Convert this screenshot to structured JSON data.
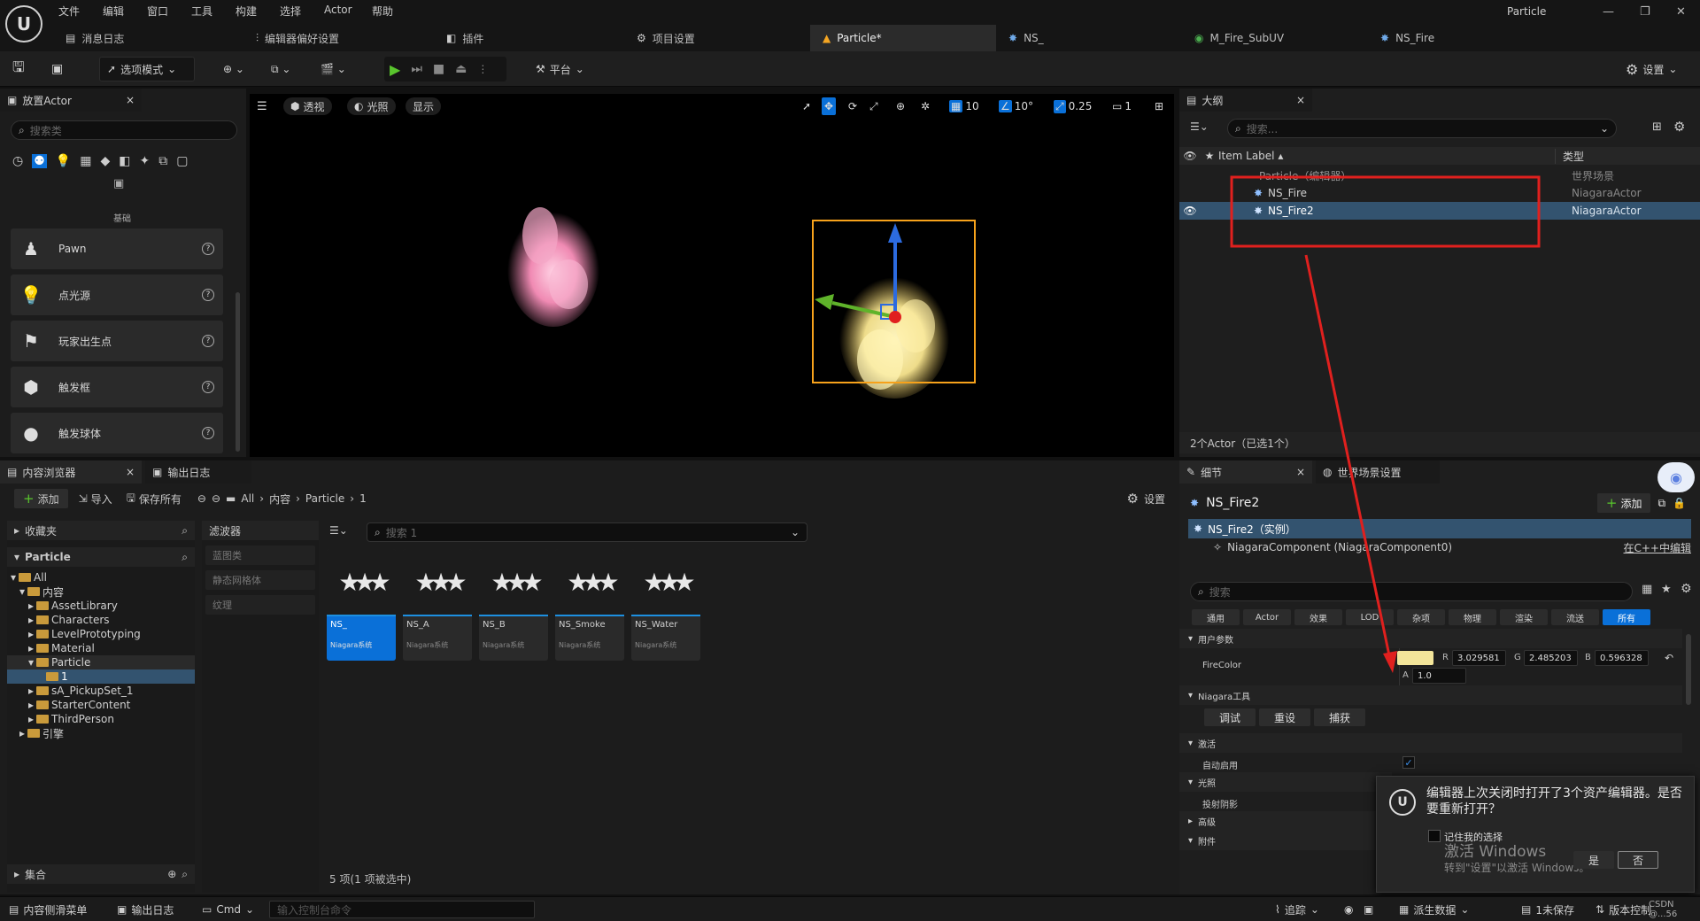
{
  "menu": [
    "文件",
    "编辑",
    "窗口",
    "工具",
    "构建",
    "选择",
    "Actor",
    "帮助"
  ],
  "window_title": "Particle",
  "doc_tabs": [
    {
      "label": "消息日志",
      "icon": "message-log-icon"
    },
    {
      "label": "编辑器偏好设置",
      "icon": "sliders-icon"
    },
    {
      "label": "插件",
      "icon": "plugin-icon"
    },
    {
      "label": "项目设置",
      "icon": "settings-icon"
    },
    {
      "label": "Particle*",
      "icon": "level-icon",
      "active": true
    },
    {
      "label": "NS_",
      "icon": "niagara-icon"
    },
    {
      "label": "M_Fire_SubUV",
      "icon": "material-icon"
    },
    {
      "label": "NS_Fire",
      "icon": "niagara-icon"
    }
  ],
  "toolbar": {
    "mode_label": "选项模式",
    "platform_label": "平台",
    "settings_label": "设置"
  },
  "place_actors": {
    "tab_label": "放置Actor",
    "search_placeholder": "搜索类",
    "category_label": "基础",
    "items": [
      {
        "label": "Pawn",
        "icon": "pawn-icon"
      },
      {
        "label": "点光源",
        "icon": "point-light-icon"
      },
      {
        "label": "玩家出生点",
        "icon": "player-start-icon"
      },
      {
        "label": "触发框",
        "icon": "trigger-box-icon"
      },
      {
        "label": "触发球体",
        "icon": "trigger-sphere-icon"
      }
    ]
  },
  "viewport": {
    "perspective_label": "透视",
    "lighting_label": "光照",
    "show_label": "显示",
    "grid_snap": "10",
    "rotation_snap": "10°",
    "scale_snap": "0.25",
    "camera_speed": "1"
  },
  "outliner": {
    "tab_label": "大纲",
    "search_placeholder": "搜索...",
    "col_label": "Item Label",
    "col_type": "类型",
    "rows": [
      {
        "label": "Particle（编辑器）",
        "type": "世界场景",
        "indent": 1
      },
      {
        "label": "NS_Fire",
        "type": "NiagaraActor",
        "indent": 2
      },
      {
        "label": "NS_Fire2",
        "type": "NiagaraActor",
        "indent": 2,
        "selected": true
      }
    ],
    "footer": "2个Actor（已选1个）"
  },
  "content_browser": {
    "tab_label": "内容浏览器",
    "output_tab_label": "输出日志",
    "add_label": "添加",
    "import_label": "导入",
    "save_all_label": "保存所有",
    "breadcrumb": [
      "All",
      "内容",
      "Particle",
      "1"
    ],
    "settings_label": "设置",
    "favorites_label": "收藏夹",
    "root_label": "Particle",
    "tree": [
      {
        "label": "All",
        "depth": 0
      },
      {
        "label": "内容",
        "depth": 1
      },
      {
        "label": "AssetLibrary",
        "depth": 2
      },
      {
        "label": "Characters",
        "depth": 2
      },
      {
        "label": "LevelPrototyping",
        "depth": 2
      },
      {
        "label": "Material",
        "depth": 2
      },
      {
        "label": "Particle",
        "depth": 2
      },
      {
        "label": "1",
        "depth": 3
      },
      {
        "label": "sA_PickupSet_1",
        "depth": 2
      },
      {
        "label": "StarterContent",
        "depth": 2
      },
      {
        "label": "ThirdPerson",
        "depth": 2
      },
      {
        "label": "引擎",
        "depth": 1
      }
    ],
    "collections_label": "集合",
    "filters_label": "滤波器",
    "filters": [
      "蓝图类",
      "静态网格体",
      "纹理"
    ],
    "search_placeholder": "搜索 1",
    "assets": [
      {
        "name": "NS_",
        "type": "Niagara系统",
        "selected": true
      },
      {
        "name": "NS_A",
        "type": "Niagara系统"
      },
      {
        "name": "NS_B",
        "type": "Niagara系统"
      },
      {
        "name": "NS_Smoke",
        "type": "Niagara系统"
      },
      {
        "name": "NS_Water",
        "type": "Niagara系统"
      }
    ],
    "status": "5 项(1 项被选中)"
  },
  "details": {
    "tab_label": "细节",
    "world_tab_label": "世界场景设置",
    "actor_name": "NS_Fire2",
    "add_label": "添加",
    "instance_label": "NS_Fire2（实例）",
    "component_label": "NiagaraComponent (NiagaraComponent0)",
    "edit_in_cpp": "在C++中编辑",
    "search_placeholder": "搜索",
    "categories": [
      "通用",
      "Actor",
      "效果",
      "LOD",
      "杂项",
      "物理",
      "渲染",
      "流送",
      "所有"
    ],
    "user_params_label": "用户参数",
    "fire_color_label": "FireColor",
    "fire_color_swatch": "#f3e59a",
    "r_label": "R",
    "r_value": "3.029581",
    "g_label": "G",
    "g_value": "2.485203",
    "b_label": "B",
    "b_value": "0.596328",
    "a_label": "A",
    "a_value": "1.0",
    "niagara_tools_label": "Niagara工具",
    "debug_label": "调试",
    "reset_label": "重设",
    "capture_label": "捕获",
    "activation_label": "激活",
    "auto_activate_label": "自动启用",
    "lighting_label": "光照",
    "cast_shadow_label": "投射阴影",
    "advanced_label": "高级",
    "attachment_label": "附件"
  },
  "dialog": {
    "message": "编辑器上次关闭时打开了3个资产编辑器。是否要重新打开？",
    "remember_label": "记住我的选择",
    "yes_label": "是",
    "no_label": "否",
    "watermark_line1": "激活 Windows",
    "watermark_line2": "转到\"设置\"以激活 Windows。"
  },
  "statusbar": {
    "content_drawer": "内容侧滑菜单",
    "output_log": "输出日志",
    "cmd_label": "Cmd",
    "console_placeholder": "输入控制台命令",
    "trace_label": "追踪",
    "derived_data_label": "派生数据",
    "unsaved_label": "1未保存",
    "source_control_label": "版本控制",
    "credit": "CSDN @...56"
  },
  "colors": {
    "accent": "#0a70d8",
    "annotation_red": "#e0201e",
    "selection_orange": "#f7a21b"
  }
}
